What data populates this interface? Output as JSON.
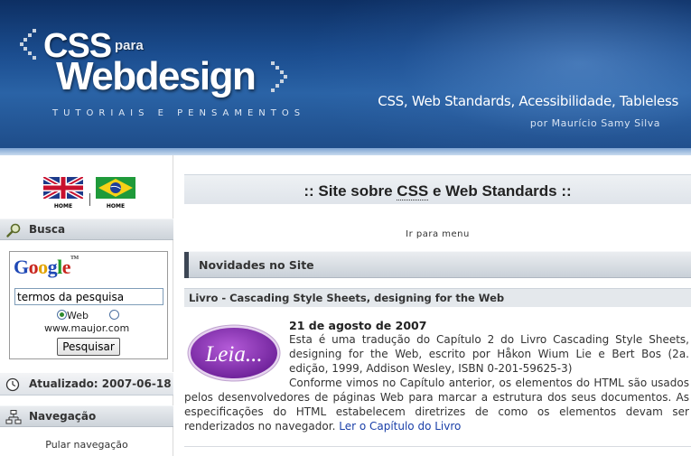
{
  "header": {
    "logo_css": "CSS",
    "logo_para": "para",
    "logo_webdesign": "Webdesign",
    "tagline": "TUTORIAIS E PENSAMENTOS",
    "subtitle": "CSS, Web Standards, Acessibilidade, Tableless",
    "author": "por Maurício Samy Silva"
  },
  "sidebar": {
    "flags": [
      {
        "icon": "uk-flag-icon",
        "label": "HOME"
      },
      {
        "icon": "brazil-flag-icon",
        "label": "HOME"
      }
    ],
    "search": {
      "title": "Busca",
      "google_logo": "Google",
      "google_tm": "TM",
      "input_value": "termos da pesquisa",
      "option_web": "Web",
      "option_site": "www.maujor.com",
      "button": "Pesquisar"
    },
    "updated": "Atualizado: 2007-06-18",
    "nav_title": "Navegação",
    "skip_nav": "Pular navegação"
  },
  "main": {
    "site_title_prefix": ":: Site sobre ",
    "site_title_abbr": "CSS",
    "site_title_suffix": " e Web Standards ::",
    "goto_menu": "Ir para menu",
    "news_title": "Novidades no Site",
    "article": {
      "title": "Livro - Cascading Style Sheets, designing for the Web",
      "badge": "Leia...",
      "date": "21 de agosto de 2007",
      "para1": "Esta é uma tradução do Capítulo 2 do Livro Cascading Style Sheets, designing for the Web, escrito por Håkon Wium Lie e Bert Bos (2a. edição, 1999, Addison Wesley, ISBN 0-201-59625-3)",
      "para2": "Conforme vimos no Capítulo anterior, os elementos do HTML são usados pelos desenvolvedores de páginas Web para marcar a estrutura dos seus documentos. As especificações do HTML estabelecem diretrizes de como os elementos devam ser renderizados no navegador.",
      "read_link": "Ler o Capítulo do Livro"
    }
  },
  "colors": {
    "header_blue": "#1b4d8f",
    "link_blue": "#1a3fa8",
    "badge_purple": "#8a2fb5"
  }
}
